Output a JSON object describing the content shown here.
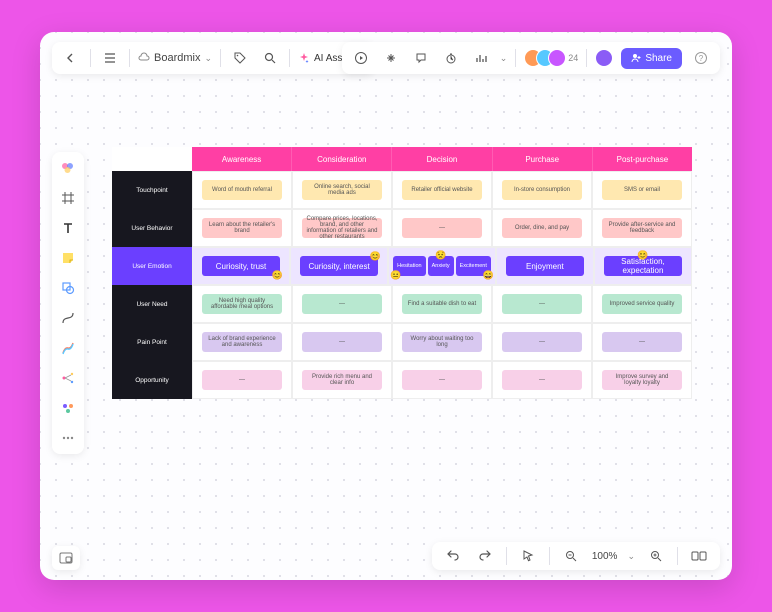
{
  "header": {
    "brand": "Boardmix",
    "ai_label": "AI Assistant",
    "avatar_extra": "24",
    "share_label": "Share"
  },
  "journey": {
    "columns": [
      "Awareness",
      "Consideration",
      "Decision",
      "Purchase",
      "Post-purchase"
    ],
    "rows": [
      {
        "label": "Touchpoint",
        "cells": [
          {
            "text": "Word of mouth referral",
            "style": "st-yellow"
          },
          {
            "text": "Online search, social media ads",
            "style": "st-yellow"
          },
          {
            "text": "Retailer official website",
            "style": "st-yellow"
          },
          {
            "text": "In-store consumption",
            "style": "st-yellow"
          },
          {
            "text": "SMS or email",
            "style": "st-yellow"
          }
        ]
      },
      {
        "label": "User Behavior",
        "cells": [
          {
            "text": "Learn about the retailer's brand",
            "style": "st-pink"
          },
          {
            "text": "Compare prices, locations, brand, and other information of retailers and other restaurants",
            "style": "st-pink"
          },
          {
            "text": "—",
            "style": "st-pink"
          },
          {
            "text": "Order, dine, and pay",
            "style": "st-pink"
          },
          {
            "text": "Provide after-service and feedback",
            "style": "st-pink"
          }
        ]
      },
      {
        "label": "User Emotion",
        "highlight": true,
        "cells": [
          {
            "text": "Curiosity, trust",
            "style": "st-purple",
            "emojis": [
              {
                "e": "😊",
                "pos": "br"
              }
            ]
          },
          {
            "text": "Curiosity, interest",
            "style": "st-purple",
            "emojis": [
              {
                "e": "😊",
                "pos": "tr"
              }
            ]
          },
          {
            "multi": [
              {
                "text": "Hesitation",
                "style": "st-purple",
                "emojis": [
                  {
                    "e": "😐",
                    "pos": "bl"
                  }
                ]
              },
              {
                "text": "Anxiety",
                "style": "st-purple",
                "emojis": [
                  {
                    "e": "😟",
                    "pos": "tc"
                  }
                ]
              },
              {
                "text": "Excitement",
                "style": "st-purple",
                "emojis": [
                  {
                    "e": "😄",
                    "pos": "br"
                  }
                ]
              }
            ]
          },
          {
            "text": "Enjoyment",
            "style": "st-purple"
          },
          {
            "text": "Satisfaction, expectation",
            "style": "st-purple",
            "emojis": [
              {
                "e": "😊",
                "pos": "tc"
              }
            ]
          }
        ]
      },
      {
        "label": "User Need",
        "cells": [
          {
            "text": "Need high quality affordable meal options",
            "style": "st-mint"
          },
          {
            "text": "—",
            "style": "st-mint"
          },
          {
            "text": "Find a suitable dish to eat",
            "style": "st-mint"
          },
          {
            "text": "—",
            "style": "st-mint"
          },
          {
            "text": "Improved service quality",
            "style": "st-mint"
          }
        ]
      },
      {
        "label": "Pain Point",
        "cells": [
          {
            "text": "Lack of brand experience and awareness",
            "style": "st-lilac"
          },
          {
            "text": "—",
            "style": "st-lilac"
          },
          {
            "text": "Worry about waiting too long",
            "style": "st-lilac"
          },
          {
            "text": "—",
            "style": "st-lilac"
          },
          {
            "text": "—",
            "style": "st-lilac"
          }
        ]
      },
      {
        "label": "Opportunity",
        "cells": [
          {
            "text": "—",
            "style": "st-rose"
          },
          {
            "text": "Provide rich menu and clear info",
            "style": "st-rose"
          },
          {
            "text": "—",
            "style": "st-rose"
          },
          {
            "text": "—",
            "style": "st-rose"
          },
          {
            "text": "Improve survey and loyalty loyalty",
            "style": "st-rose"
          }
        ]
      }
    ]
  },
  "footer": {
    "zoom": "100%"
  }
}
